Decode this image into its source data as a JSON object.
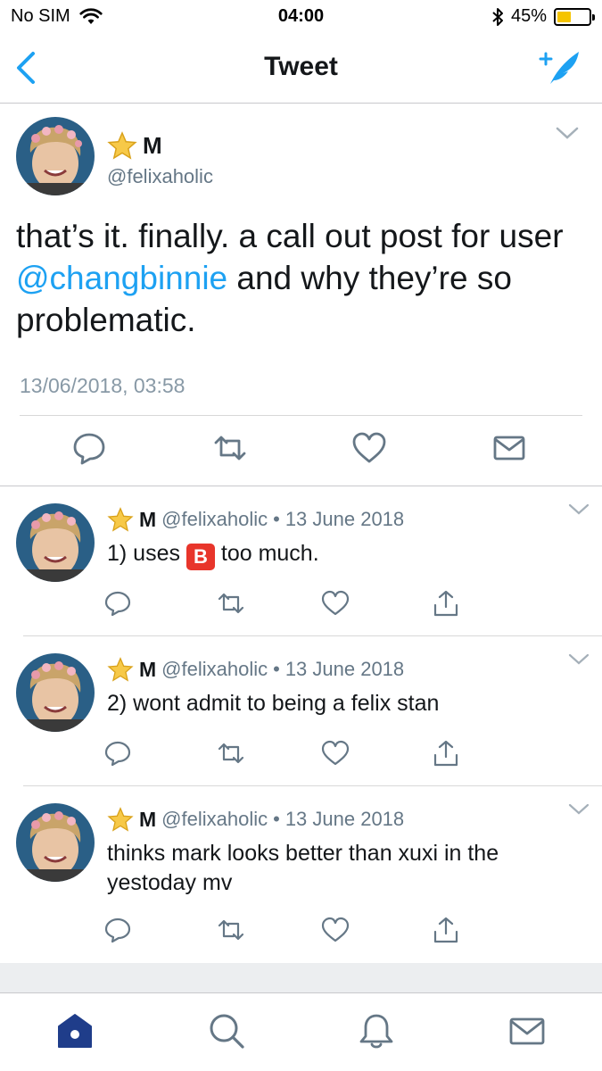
{
  "status_bar": {
    "carrier": "No SIM",
    "time": "04:00",
    "battery_percent": "45%",
    "battery_level": 0.45,
    "icons": [
      "wifi-icon",
      "bluetooth-icon",
      "battery-icon"
    ]
  },
  "nav": {
    "title": "Tweet",
    "back_icon": "chevron-left-icon",
    "compose_icon": "compose-feather-icon"
  },
  "main_tweet": {
    "display_name": "M",
    "handle": "@felixaholic",
    "text_before": "that’s it. finally. a call out post for user ",
    "mention": "@changbinnie",
    "text_after": " and why they’re so problematic.",
    "timestamp": "13/06/2018, 03:58",
    "actions": [
      "reply-icon",
      "retweet-icon",
      "like-icon",
      "message-icon"
    ]
  },
  "replies": [
    {
      "display_name": "M",
      "handle": "@felixaholic",
      "separator": "•",
      "date": "13 June 2018",
      "text_before": "1) uses ",
      "emoji": "B",
      "text_after": " too much."
    },
    {
      "display_name": "M",
      "handle": "@felixaholic",
      "separator": "•",
      "date": "13 June 2018",
      "text": "2) wont admit to being a felix stan"
    },
    {
      "display_name": "M",
      "handle": "@felixaholic",
      "separator": "•",
      "date": "13 June 2018",
      "text": "thinks mark looks better than xuxi in the yestoday mv"
    }
  ],
  "tab_bar": {
    "tabs": [
      "home-icon",
      "search-icon",
      "notifications-icon",
      "messages-icon"
    ],
    "active_tab": "home-icon"
  },
  "colors": {
    "accent": "#1da1f2",
    "active_tab": "#1f3d8a",
    "muted_text": "#657786",
    "badge_red": "#e8352b",
    "star": "#f7c948"
  }
}
